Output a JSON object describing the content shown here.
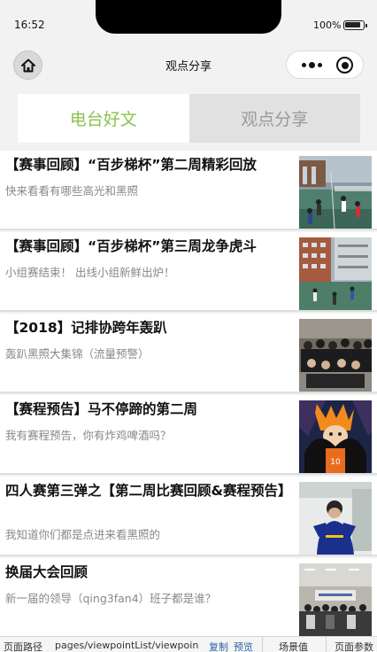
{
  "status_bar": {
    "time": "16:52",
    "battery": "100%"
  },
  "nav": {
    "title": "观点分享"
  },
  "tabs": [
    {
      "label": "电台好文",
      "active": true
    },
    {
      "label": "观点分享",
      "active": false
    }
  ],
  "articles": [
    {
      "title": "【赛事回顾】“百步梯杯”第二周精彩回放",
      "desc": "快来看看有哪些高光和黑照"
    },
    {
      "title": "【赛事回顾】“百步梯杯”第三周龙争虎斗",
      "desc": "小组赛结束！ 出线小组新鲜出炉！"
    },
    {
      "title": "【2018】记排协跨年轰趴",
      "desc": "轰趴黑照大集锦（流量预警）"
    },
    {
      "title": "【赛程预告】马不停蹄的第二周",
      "desc": "我有赛程预告，你有炸鸡啤酒吗？"
    },
    {
      "title": "四人赛第三弹之【第二周比赛回顾&赛程预告】",
      "desc": "我知道你们都是点进来看黑照的"
    },
    {
      "title": "换届大会回顾",
      "desc": "新一届的领导（qing3fan4）班子都是谁？"
    }
  ],
  "bottom_bar": {
    "path_label": "页面路径",
    "path_value": "pages/viewpointList/viewpoin",
    "copy_label": "复制",
    "preview_label": "预览",
    "scene_label": "场景值",
    "params_label": "页面参数"
  }
}
